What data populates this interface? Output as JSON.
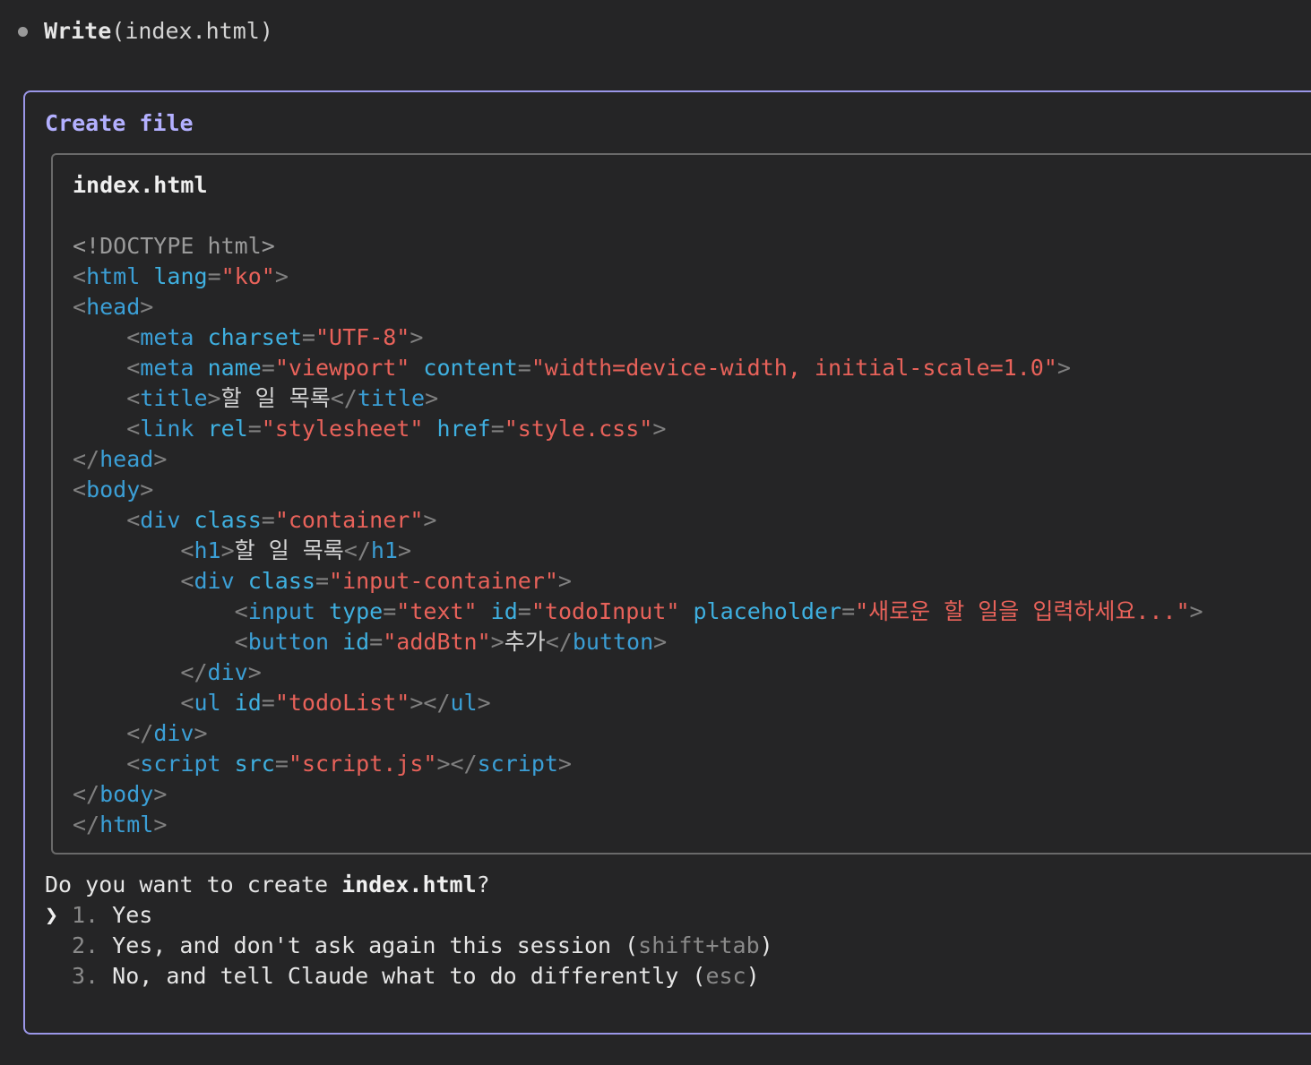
{
  "tool_call": {
    "name": "Write",
    "args": "(index.html)"
  },
  "dialog": {
    "title": "Create file",
    "file_name": "index.html",
    "code_lines": [
      [
        {
          "t": "doctype",
          "v": "<!DOCTYPE html>"
        }
      ],
      [
        {
          "t": "punct",
          "v": "<"
        },
        {
          "t": "tag",
          "v": "html"
        },
        {
          "t": "txt",
          "v": " "
        },
        {
          "t": "attr",
          "v": "lang"
        },
        {
          "t": "punct",
          "v": "="
        },
        {
          "t": "str",
          "v": "\"ko\""
        },
        {
          "t": "punct",
          "v": ">"
        }
      ],
      [
        {
          "t": "punct",
          "v": "<"
        },
        {
          "t": "tag",
          "v": "head"
        },
        {
          "t": "punct",
          "v": ">"
        }
      ],
      [
        {
          "t": "txt",
          "v": "    "
        },
        {
          "t": "punct",
          "v": "<"
        },
        {
          "t": "tag",
          "v": "meta"
        },
        {
          "t": "txt",
          "v": " "
        },
        {
          "t": "attr",
          "v": "charset"
        },
        {
          "t": "punct",
          "v": "="
        },
        {
          "t": "str",
          "v": "\"UTF-8\""
        },
        {
          "t": "punct",
          "v": ">"
        }
      ],
      [
        {
          "t": "txt",
          "v": "    "
        },
        {
          "t": "punct",
          "v": "<"
        },
        {
          "t": "tag",
          "v": "meta"
        },
        {
          "t": "txt",
          "v": " "
        },
        {
          "t": "attr",
          "v": "name"
        },
        {
          "t": "punct",
          "v": "="
        },
        {
          "t": "str",
          "v": "\"viewport\""
        },
        {
          "t": "txt",
          "v": " "
        },
        {
          "t": "attr",
          "v": "content"
        },
        {
          "t": "punct",
          "v": "="
        },
        {
          "t": "str",
          "v": "\"width=device-width, initial-scale=1.0\""
        },
        {
          "t": "punct",
          "v": ">"
        }
      ],
      [
        {
          "t": "txt",
          "v": "    "
        },
        {
          "t": "punct",
          "v": "<"
        },
        {
          "t": "tag",
          "v": "title"
        },
        {
          "t": "punct",
          "v": ">"
        },
        {
          "t": "txt",
          "v": "할 일 목록"
        },
        {
          "t": "punct",
          "v": "</"
        },
        {
          "t": "tag",
          "v": "title"
        },
        {
          "t": "punct",
          "v": ">"
        }
      ],
      [
        {
          "t": "txt",
          "v": "    "
        },
        {
          "t": "punct",
          "v": "<"
        },
        {
          "t": "tag",
          "v": "link"
        },
        {
          "t": "txt",
          "v": " "
        },
        {
          "t": "attr",
          "v": "rel"
        },
        {
          "t": "punct",
          "v": "="
        },
        {
          "t": "str",
          "v": "\"stylesheet\""
        },
        {
          "t": "txt",
          "v": " "
        },
        {
          "t": "attr",
          "v": "href"
        },
        {
          "t": "punct",
          "v": "="
        },
        {
          "t": "str",
          "v": "\"style.css\""
        },
        {
          "t": "punct",
          "v": ">"
        }
      ],
      [
        {
          "t": "punct",
          "v": "</"
        },
        {
          "t": "tag",
          "v": "head"
        },
        {
          "t": "punct",
          "v": ">"
        }
      ],
      [
        {
          "t": "punct",
          "v": "<"
        },
        {
          "t": "tag",
          "v": "body"
        },
        {
          "t": "punct",
          "v": ">"
        }
      ],
      [
        {
          "t": "txt",
          "v": "    "
        },
        {
          "t": "punct",
          "v": "<"
        },
        {
          "t": "tag",
          "v": "div"
        },
        {
          "t": "txt",
          "v": " "
        },
        {
          "t": "attr",
          "v": "class"
        },
        {
          "t": "punct",
          "v": "="
        },
        {
          "t": "str",
          "v": "\"container\""
        },
        {
          "t": "punct",
          "v": ">"
        }
      ],
      [
        {
          "t": "txt",
          "v": "        "
        },
        {
          "t": "punct",
          "v": "<"
        },
        {
          "t": "tag",
          "v": "h1"
        },
        {
          "t": "punct",
          "v": ">"
        },
        {
          "t": "txt",
          "v": "할 일 목록"
        },
        {
          "t": "punct",
          "v": "</"
        },
        {
          "t": "tag",
          "v": "h1"
        },
        {
          "t": "punct",
          "v": ">"
        }
      ],
      [
        {
          "t": "txt",
          "v": "        "
        },
        {
          "t": "punct",
          "v": "<"
        },
        {
          "t": "tag",
          "v": "div"
        },
        {
          "t": "txt",
          "v": " "
        },
        {
          "t": "attr",
          "v": "class"
        },
        {
          "t": "punct",
          "v": "="
        },
        {
          "t": "str",
          "v": "\"input-container\""
        },
        {
          "t": "punct",
          "v": ">"
        }
      ],
      [
        {
          "t": "txt",
          "v": "            "
        },
        {
          "t": "punct",
          "v": "<"
        },
        {
          "t": "tag",
          "v": "input"
        },
        {
          "t": "txt",
          "v": " "
        },
        {
          "t": "attr",
          "v": "type"
        },
        {
          "t": "punct",
          "v": "="
        },
        {
          "t": "str",
          "v": "\"text\""
        },
        {
          "t": "txt",
          "v": " "
        },
        {
          "t": "attr",
          "v": "id"
        },
        {
          "t": "punct",
          "v": "="
        },
        {
          "t": "str",
          "v": "\"todoInput\""
        },
        {
          "t": "txt",
          "v": " "
        },
        {
          "t": "attr",
          "v": "placeholder"
        },
        {
          "t": "punct",
          "v": "="
        },
        {
          "t": "str",
          "v": "\"새로운 할 일을 입력하세요...\""
        },
        {
          "t": "punct",
          "v": ">"
        }
      ],
      [
        {
          "t": "txt",
          "v": "            "
        },
        {
          "t": "punct",
          "v": "<"
        },
        {
          "t": "tag",
          "v": "button"
        },
        {
          "t": "txt",
          "v": " "
        },
        {
          "t": "attr",
          "v": "id"
        },
        {
          "t": "punct",
          "v": "="
        },
        {
          "t": "str",
          "v": "\"addBtn\""
        },
        {
          "t": "punct",
          "v": ">"
        },
        {
          "t": "txt",
          "v": "추가"
        },
        {
          "t": "punct",
          "v": "</"
        },
        {
          "t": "tag",
          "v": "button"
        },
        {
          "t": "punct",
          "v": ">"
        }
      ],
      [
        {
          "t": "txt",
          "v": "        "
        },
        {
          "t": "punct",
          "v": "</"
        },
        {
          "t": "tag",
          "v": "div"
        },
        {
          "t": "punct",
          "v": ">"
        }
      ],
      [
        {
          "t": "txt",
          "v": "        "
        },
        {
          "t": "punct",
          "v": "<"
        },
        {
          "t": "tag",
          "v": "ul"
        },
        {
          "t": "txt",
          "v": " "
        },
        {
          "t": "attr",
          "v": "id"
        },
        {
          "t": "punct",
          "v": "="
        },
        {
          "t": "str",
          "v": "\"todoList\""
        },
        {
          "t": "punct",
          "v": "></"
        },
        {
          "t": "tag",
          "v": "ul"
        },
        {
          "t": "punct",
          "v": ">"
        }
      ],
      [
        {
          "t": "txt",
          "v": "    "
        },
        {
          "t": "punct",
          "v": "</"
        },
        {
          "t": "tag",
          "v": "div"
        },
        {
          "t": "punct",
          "v": ">"
        }
      ],
      [
        {
          "t": "txt",
          "v": "    "
        },
        {
          "t": "punct",
          "v": "<"
        },
        {
          "t": "tag",
          "v": "script"
        },
        {
          "t": "txt",
          "v": " "
        },
        {
          "t": "attr",
          "v": "src"
        },
        {
          "t": "punct",
          "v": "="
        },
        {
          "t": "str",
          "v": "\"script.js\""
        },
        {
          "t": "punct",
          "v": "></"
        },
        {
          "t": "tag",
          "v": "script"
        },
        {
          "t": "punct",
          "v": ">"
        }
      ],
      [
        {
          "t": "punct",
          "v": "</"
        },
        {
          "t": "tag",
          "v": "body"
        },
        {
          "t": "punct",
          "v": ">"
        }
      ],
      [
        {
          "t": "punct",
          "v": "</"
        },
        {
          "t": "tag",
          "v": "html"
        },
        {
          "t": "punct",
          "v": ">"
        }
      ]
    ]
  },
  "prompt": {
    "question_prefix": "Do you want to create ",
    "question_file": "index.html",
    "question_suffix": "?",
    "cursor_icon": "❯",
    "options": [
      {
        "num": "1.",
        "label": "Yes",
        "hint": "",
        "selected": true
      },
      {
        "num": "2.",
        "label": "Yes, and don't ask again this session ",
        "hint": "shift+tab",
        "selected": false
      },
      {
        "num": "3.",
        "label": "No, and tell Claude what to do differently ",
        "hint": "esc",
        "selected": false
      }
    ]
  },
  "colors": {
    "background": "#252526",
    "dialog_border": "#9b97e8",
    "title": "#b3b0ff",
    "tag": "#3b9fd6",
    "attr": "#3fb0e0",
    "string": "#e8625a"
  }
}
